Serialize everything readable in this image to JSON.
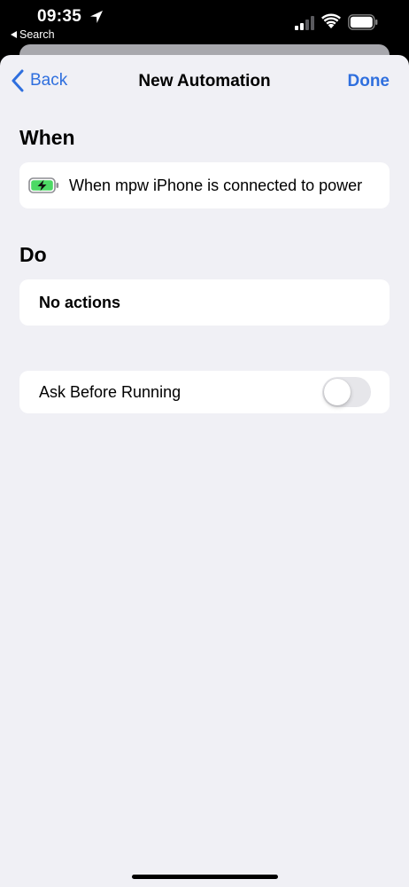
{
  "status_bar": {
    "time": "09:35",
    "back_app": "Search"
  },
  "nav": {
    "back_label": "Back",
    "title": "New Automation",
    "done_label": "Done"
  },
  "when": {
    "heading": "When",
    "trigger_text": "When mpw iPhone is connected to power",
    "trigger_icon": "battery-charging-icon"
  },
  "do": {
    "heading": "Do",
    "actions_text": "No actions"
  },
  "ask": {
    "label": "Ask Before Running",
    "toggle_on": false
  },
  "colors": {
    "accent": "#2f6fde",
    "background": "#f0f0f5",
    "card": "#ffffff",
    "battery_green": "#4cd964"
  }
}
